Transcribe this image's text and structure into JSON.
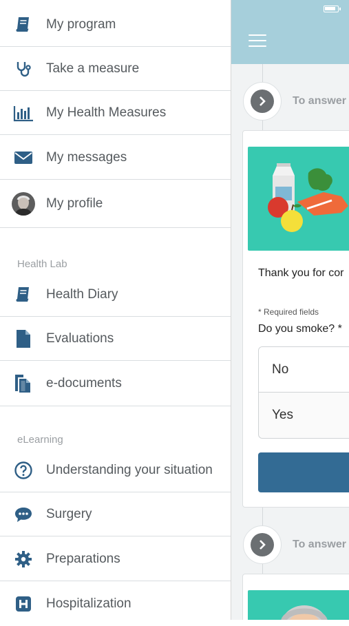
{
  "drawer": {
    "main_items": [
      {
        "label": "My program",
        "icon": "book-icon"
      },
      {
        "label": "Take a measure",
        "icon": "stethoscope-icon"
      },
      {
        "label": "My Health Measures",
        "icon": "bar-chart-icon"
      },
      {
        "label": "My messages",
        "icon": "envelope-icon"
      },
      {
        "label": "My profile",
        "icon": "avatar"
      }
    ],
    "health_lab": {
      "title": "Health Lab",
      "items": [
        {
          "label": "Health Diary",
          "icon": "book-icon"
        },
        {
          "label": "Evaluations",
          "icon": "document-icon"
        },
        {
          "label": "e-documents",
          "icon": "documents-icon"
        }
      ]
    },
    "elearning": {
      "title": "eLearning",
      "items": [
        {
          "label": "Understanding your situation",
          "icon": "question-circle-icon"
        },
        {
          "label": "Surgery",
          "icon": "chat-bubble-icon"
        },
        {
          "label": "Preparations",
          "icon": "gear-icon"
        },
        {
          "label": "Hospitalization",
          "icon": "hospital-icon"
        }
      ]
    }
  },
  "main": {
    "steps": [
      {
        "label": "To answer"
      },
      {
        "label": "To answer"
      }
    ],
    "card": {
      "intro": "Thank you for cor",
      "required_note": "* Required fields",
      "question": "Do you smoke? *",
      "options": [
        "No",
        "Yes"
      ]
    }
  },
  "colors": {
    "icon": "#2f5f86",
    "header": "#a6cfdb",
    "button": "#336b94",
    "teal": "#37c9b0"
  }
}
